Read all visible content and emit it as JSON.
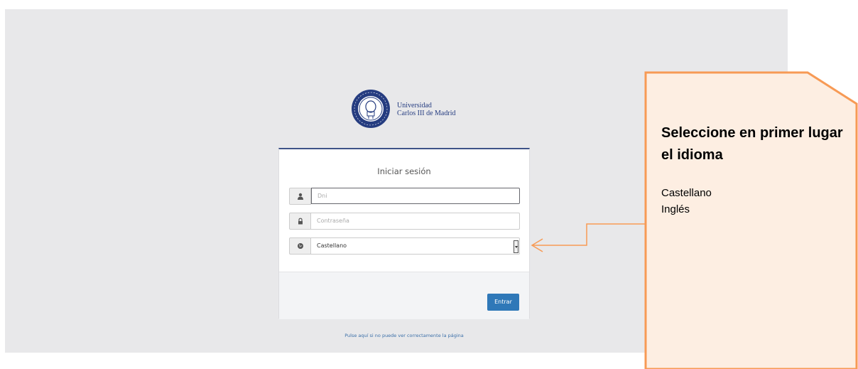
{
  "logo": {
    "line1": "Universidad",
    "line2": "Carlos III de Madrid"
  },
  "login": {
    "title": "Iniciar sesión",
    "dni_placeholder": "Dni",
    "password_placeholder": "Contraseña",
    "language_selected": "Castellano",
    "submit_label": "Entrar",
    "help_link": "Pulse aquí si no puede ver correctamente la página"
  },
  "callout": {
    "heading": "Seleccione en primer lugar el idioma",
    "options": [
      "Castellano",
      "Inglés"
    ]
  },
  "colors": {
    "accent_blue": "#2f78b8",
    "callout_fill": "#fdeee2",
    "callout_border": "#f79a55"
  }
}
